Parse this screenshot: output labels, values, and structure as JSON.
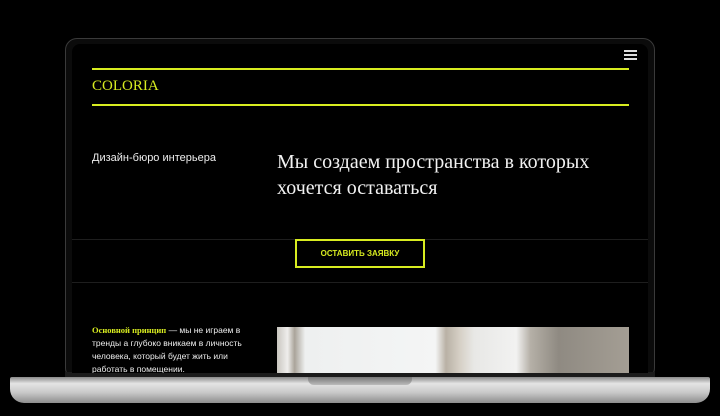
{
  "site": {
    "logo": "COLORIA",
    "menu_icon": "hamburger-icon",
    "subtitle": "Дизайн-бюро интерьера",
    "headline": "Мы создаем пространства в которых хочется оставаться",
    "cta_label": "ОСТАВИТЬ ЗАЯВКУ",
    "principle_title": "Основной принцип",
    "principle_text": " — мы не играем в тренды а глубоко вникаем в личность человека, который будет жить или работать в помещении.",
    "accent_color": "#d8ec20"
  }
}
